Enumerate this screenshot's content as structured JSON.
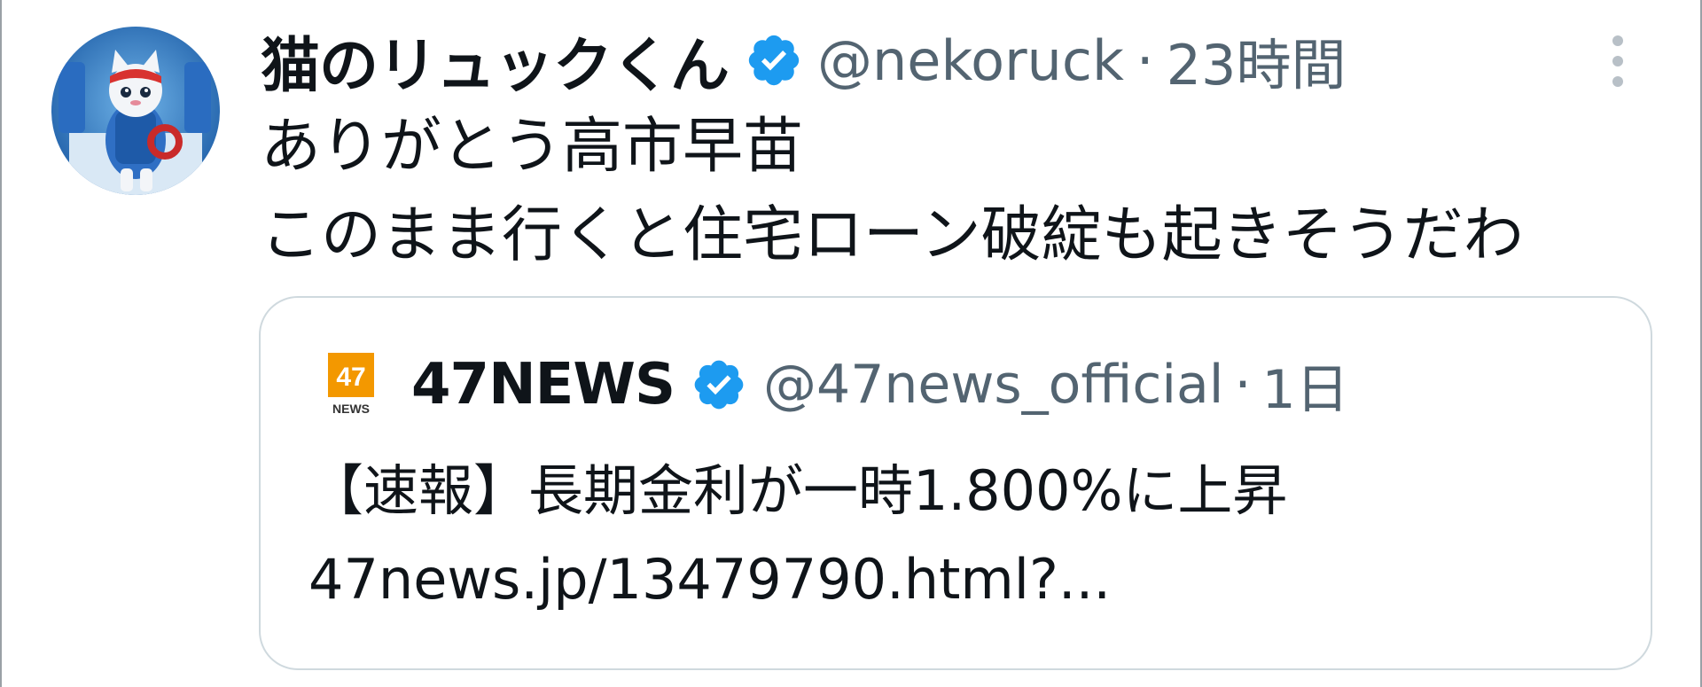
{
  "tweet": {
    "display_name": "猫のリュックくん",
    "handle": "@nekoruck",
    "separator": "·",
    "time": "23時間",
    "verified": true,
    "text_line1": "ありがとう高市早苗",
    "text_line2": "このまま行くと住宅ローン破綻も起きそうだわ",
    "more_icon": "more-vertical-icon",
    "avatar_icon": "cat-backpack-avatar"
  },
  "quote": {
    "logo_text": "47",
    "logo_subtext": "NEWS",
    "display_name": "47NEWS",
    "handle": "@47news_official",
    "separator": "·",
    "time": "1日",
    "verified": true,
    "headline": "【速報】長期金利が一時1.800%に上昇",
    "link": "47news.jp/13479790.html?..."
  },
  "colors": {
    "verified_blue": "#1d9bf0",
    "secondary_text": "#536471",
    "primary_text": "#0f1419",
    "border": "#cfd9de",
    "logo_orange": "#f39800"
  }
}
